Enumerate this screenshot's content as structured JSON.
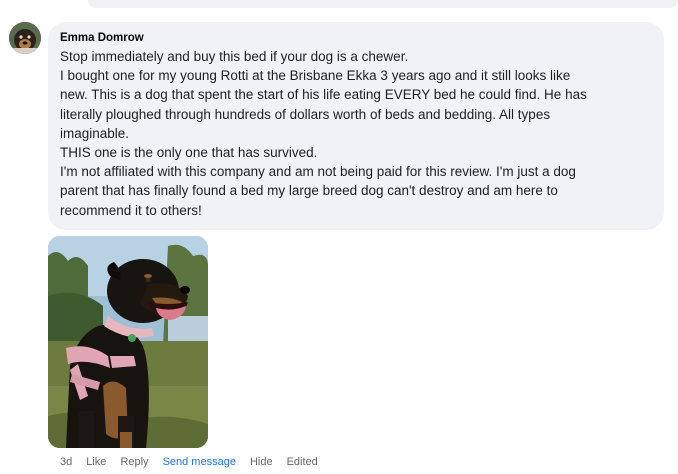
{
  "comment": {
    "author": "Emma Domrow",
    "body_lines": [
      "Stop immediately and buy this bed if your dog is a chewer.",
      "I bought one for my young Rotti at the Brisbane Ekka 3 years ago and it still looks like",
      "new. This is a dog that spent the start of his life eating EVERY bed he could find. He has",
      "literally ploughed through hundreds of dollars worth of beds and bedding. All types",
      "imaginable.",
      "THIS one is the only one that has survived.",
      "I'm not affiliated with this company and am not being paid for this review. I'm just a dog",
      "parent that has finally found a bed my large breed dog can't destroy and am here to",
      "recommend it to others!"
    ],
    "attachment_icon": "photo-of-rottweiler-dog",
    "actions": {
      "timestamp": "3d",
      "like": "Like",
      "reply": "Reply",
      "send_message": "Send message",
      "hide": "Hide",
      "edited": "Edited"
    }
  },
  "colors": {
    "bubble": "#f0f2f5",
    "link_blue": "#1b74e4",
    "meta_gray": "#65676b"
  }
}
